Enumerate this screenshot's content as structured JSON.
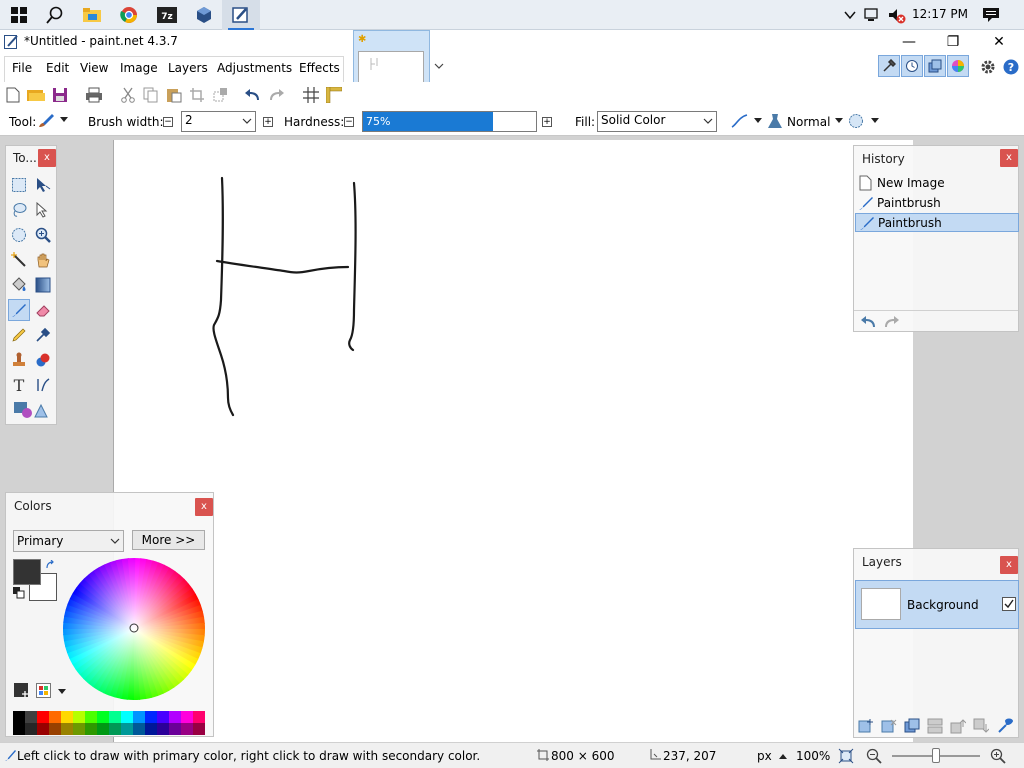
{
  "taskbar": {
    "clock": "12:17 PM",
    "pinned": [
      "start-icon",
      "search-icon",
      "file-explorer-icon",
      "chrome-icon",
      "7zip-icon",
      "virtualbox-icon",
      "paintnet-icon"
    ]
  },
  "window": {
    "title": "*Untitled - paint.net 4.3.7",
    "minimize": "—",
    "maximize": "❐",
    "close": "✕"
  },
  "menu": {
    "items": [
      "File",
      "Edit",
      "View",
      "Image",
      "Layers",
      "Adjustments",
      "Effects"
    ]
  },
  "options": {
    "tool_label": "Tool:",
    "brush_width_label": "Brush width:",
    "brush_width_value": "2",
    "hardness_label": "Hardness:",
    "hardness_value": "75%",
    "hardness_fraction": 0.75,
    "fill_label": "Fill:",
    "fill_value": "Solid Color",
    "blend_mode": "Normal"
  },
  "tools_panel": {
    "title": "To...",
    "close": "x",
    "selected": "paintbrush"
  },
  "history_panel": {
    "title": "History",
    "close": "x",
    "items": [
      "New Image",
      "Paintbrush",
      "Paintbrush"
    ],
    "selected_index": 2
  },
  "colors_panel": {
    "title": "Colors",
    "close": "x",
    "mode": "Primary",
    "more_button": "More >>",
    "primary_color": "#333333",
    "secondary_color": "#ffffff",
    "palette": [
      "#000000",
      "#404040",
      "#ff0000",
      "#ff6a00",
      "#ffd800",
      "#b6ff00",
      "#4cff00",
      "#00ff21",
      "#00ff90",
      "#00ffff",
      "#0094ff",
      "#0026ff",
      "#4800ff",
      "#b200ff",
      "#ff00dc",
      "#ff006e"
    ]
  },
  "layers_panel": {
    "title": "Layers",
    "close": "x",
    "layers": [
      {
        "name": "Background",
        "visible": true
      }
    ]
  },
  "statusbar": {
    "hint": "Left click to draw with primary color, right click to draw with secondary color.",
    "image_size": "800 × 600",
    "cursor_pos": "237, 207",
    "units": "px",
    "zoom": "100%"
  },
  "accent_color": "#2c76d6"
}
